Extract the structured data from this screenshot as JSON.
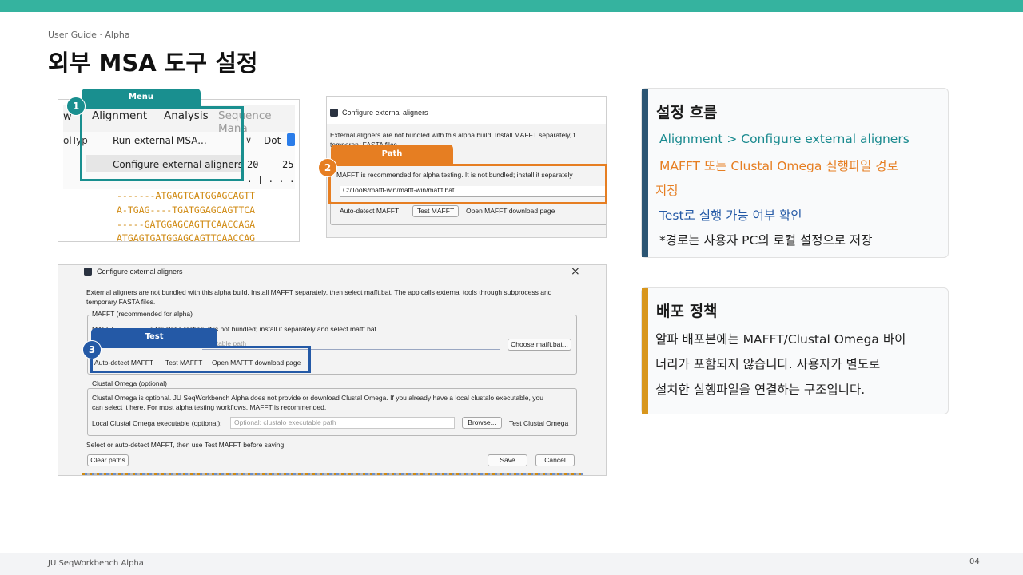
{
  "page": {
    "eyebrow": "User Guide · Alpha",
    "title": "외부 MSA 도구 설정",
    "footer_left": "JU SeqWorkbench Alpha",
    "page_number": "04"
  },
  "colors": {
    "accent": "#35b39f",
    "teal": "#198f8f",
    "orange": "#e67e22",
    "blue": "#2459a6",
    "navy": "#2b5573",
    "gold": "#d8961c"
  },
  "shot1": {
    "callout_tag": "Menu",
    "callout_num": "1",
    "menubar": [
      "w",
      "Alignment",
      "Analysis",
      "Sequence Mana"
    ],
    "menu_items": [
      "Run external MSA...",
      "Configure external aligners"
    ],
    "side_left": "olTyp",
    "dropdown_chevron": "∨",
    "dot_label": "Dot",
    "ruler_nums": [
      "20",
      "25"
    ],
    "ruler_marks": ". | . . . . |",
    "seq_lines": [
      "-------ATGAGTGATGGAGCAGTT",
      "A-TGAG----TGATGGAGCAGTTCA",
      "-----GATGGAGCAGTTCAACCAGA",
      "ATGAGTGATGGAGCAGTTCAACCAG"
    ]
  },
  "shot2": {
    "callout_tag": "Path",
    "callout_num": "2",
    "dialog_title": "Configure external aligners",
    "notice": "External aligners are not bundled with this alpha build. Install MAFFT separately, t",
    "notice2": "temporary FASTA files.",
    "recommend": "MAFFT is recommended for alpha testing. It is not bundled; install it separately",
    "path_value": "C:/Tools/mafft-win/mafft-win/mafft.bat",
    "buttons": [
      "Auto-detect MAFFT",
      "Test MAFFT",
      "Open MAFFT download page"
    ]
  },
  "shot3": {
    "callout_tag": "Test",
    "callout_num": "3",
    "dialog_title": "Configure external aligners",
    "close_icon": "×",
    "notice_l1": "External aligners are not bundled with this alpha build. Install MAFFT separately, then select mafft.bat. The app calls external tools through subprocess and",
    "notice_l2": "temporary FASTA files.",
    "mafft_group": "MAFFT (recommended for alpha)",
    "mafft_text": "MAFFT i                 d for alpha testing. It is not bundled; install it separately and select mafft.bat.",
    "mafft_placeholder": "ecutable path",
    "choose_btn": "Choose mafft.bat...",
    "mafft_buttons": [
      "Auto-detect MAFFT",
      "Test MAFFT",
      "Open MAFFT download page"
    ],
    "clustal_group": "Clustal Omega (optional)",
    "clustal_l1": "Clustal Omega is optional. JU SeqWorkbench Alpha does not provide or download Clustal Omega. If you already have a local clustalo executable, you",
    "clustal_l2": "can select it here. For most alpha testing workflows, MAFFT is recommended.",
    "clustal_label": "Local Clustal Omega executable (optional):",
    "clustal_placeholder": "Optional: clustalo executable path",
    "browse_btn": "Browse...",
    "test_clustal_btn": "Test Clustal Omega",
    "status": "Select or auto-detect MAFFT, then use Test MAFFT before saving.",
    "clear_btn": "Clear paths",
    "save_btn": "Save",
    "cancel_btn": "Cancel"
  },
  "flow_card": {
    "heading": "설정 흐름",
    "step1": "Alignment > Configure external aligners",
    "step2a": "MAFFT 또는 Clustal Omega 실행파일 경로",
    "step2b": "지정",
    "step3": "Test로 실행 가능 여부 확인",
    "note": "*경로는 사용자 PC의 로컬 설정으로 저장"
  },
  "policy_card": {
    "heading": "배포 정책",
    "line1": "알파 배포본에는 MAFFT/Clustal Omega 바이",
    "line2": "너리가 포함되지 않습니다. 사용자가 별도로",
    "line3": "설치한 실행파일을 연결하는 구조입니다."
  }
}
